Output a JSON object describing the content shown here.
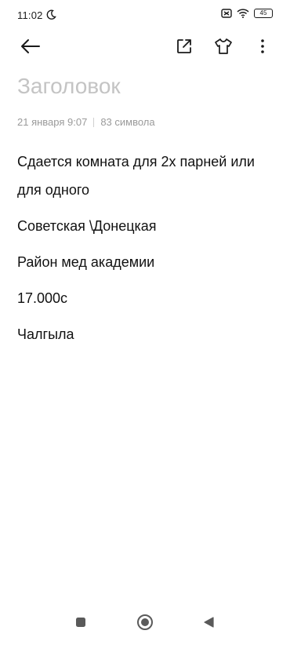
{
  "status_bar": {
    "time": "11:02",
    "battery": "45"
  },
  "toolbar": {
    "back_icon": "arrow-left-icon",
    "share_icon": "share-external-icon",
    "theme_icon": "tshirt-icon",
    "more_icon": "more-vertical-icon"
  },
  "note": {
    "title_placeholder": "Заголовок",
    "date": "21 января 9:07",
    "char_count": "83 символа",
    "paragraphs": [
      "Сдается комната для 2х парней или для одного",
      "Советская \\Донецкая",
      "Район мед академии",
      "17.000с",
      "Чалгыла"
    ]
  },
  "navbar": {
    "recent_icon": "square-icon",
    "home_icon": "circle-icon",
    "back_icon": "triangle-back-icon"
  }
}
